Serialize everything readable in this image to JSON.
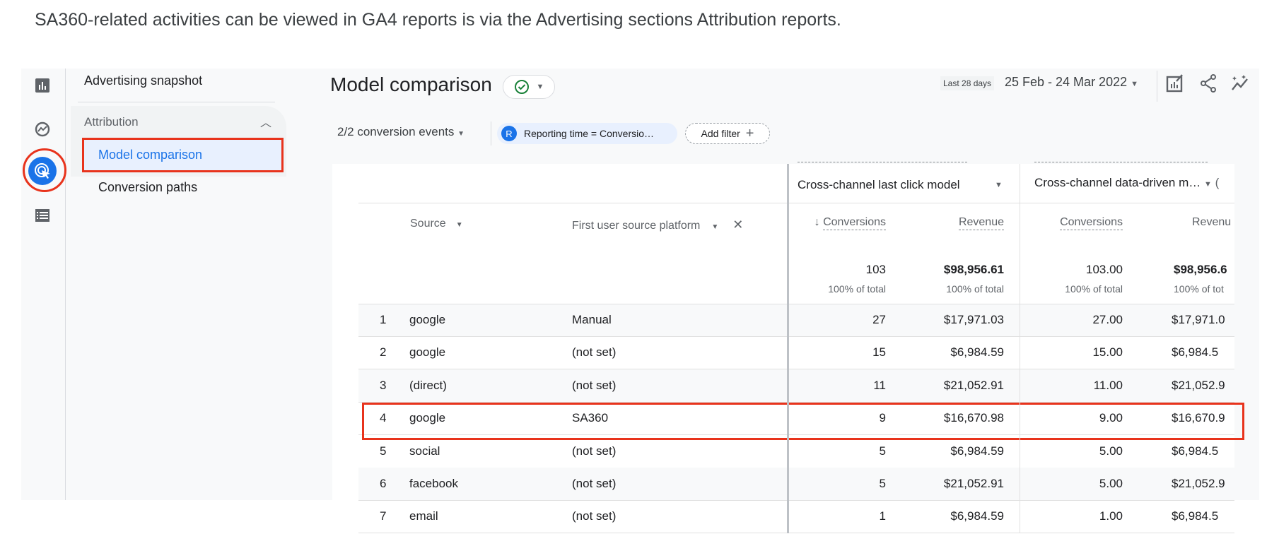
{
  "caption": "SA360-related activities can be viewed in GA4 reports is via the Advertising sections Attribution reports.",
  "rail": {
    "icons": [
      "bar-chart-icon",
      "explore-icon",
      "advertising-icon",
      "list-icon"
    ],
    "active_color": "#1a73e8"
  },
  "nav": {
    "advertising_snapshot": "Advertising snapshot",
    "section": "Attribution",
    "items": [
      {
        "label": "Model comparison",
        "active": true
      },
      {
        "label": "Conversion paths",
        "active": false
      }
    ]
  },
  "header": {
    "title": "Model comparison",
    "date_badge": "Last 28 days",
    "date_range": "25 Feb - 24 Mar 2022"
  },
  "filters": {
    "conversion_events": "2/2 conversion events",
    "chip_avatar": "R",
    "chip_label": "Reporting time = Conversio…",
    "add_filter": "Add filter"
  },
  "table": {
    "models": [
      "Cross-channel last click model",
      "Cross-channel data-driven m…"
    ],
    "columns": {
      "source": "Source",
      "platform": "First user source platform",
      "conv1": "Conversions",
      "rev1": "Revenue",
      "conv2": "Conversions",
      "rev2": "Revenu"
    },
    "totals": {
      "conv1": "103",
      "rev1": "$98,956.61",
      "conv2": "103.00",
      "rev2": "$98,956.6",
      "pct": "100% of total",
      "pct_cut": "100% of tot"
    },
    "rows": [
      {
        "i": "1",
        "source": "google",
        "platform": "Manual",
        "conv1": "27",
        "rev1": "$17,971.03",
        "conv2": "27.00",
        "rev2": "$17,971.0"
      },
      {
        "i": "2",
        "source": "google",
        "platform": "(not set)",
        "conv1": "15",
        "rev1": "$6,984.59",
        "conv2": "15.00",
        "rev2": "$6,984.5"
      },
      {
        "i": "3",
        "source": "(direct)",
        "platform": "(not set)",
        "conv1": "11",
        "rev1": "$21,052.91",
        "conv2": "11.00",
        "rev2": "$21,052.9"
      },
      {
        "i": "4",
        "source": "google",
        "platform": "SA360",
        "conv1": "9",
        "rev1": "$16,670.98",
        "conv2": "9.00",
        "rev2": "$16,670.9"
      },
      {
        "i": "5",
        "source": "social",
        "platform": "(not set)",
        "conv1": "5",
        "rev1": "$6,984.59",
        "conv2": "5.00",
        "rev2": "$6,984.5"
      },
      {
        "i": "6",
        "source": "facebook",
        "platform": "(not set)",
        "conv1": "5",
        "rev1": "$21,052.91",
        "conv2": "5.00",
        "rev2": "$21,052.9"
      },
      {
        "i": "7",
        "source": "email",
        "platform": "(not set)",
        "conv1": "1",
        "rev1": "$6,984.59",
        "conv2": "1.00",
        "rev2": "$6,984.5"
      }
    ],
    "highlight_row": "4",
    "highlight_color": "#e8331c"
  }
}
